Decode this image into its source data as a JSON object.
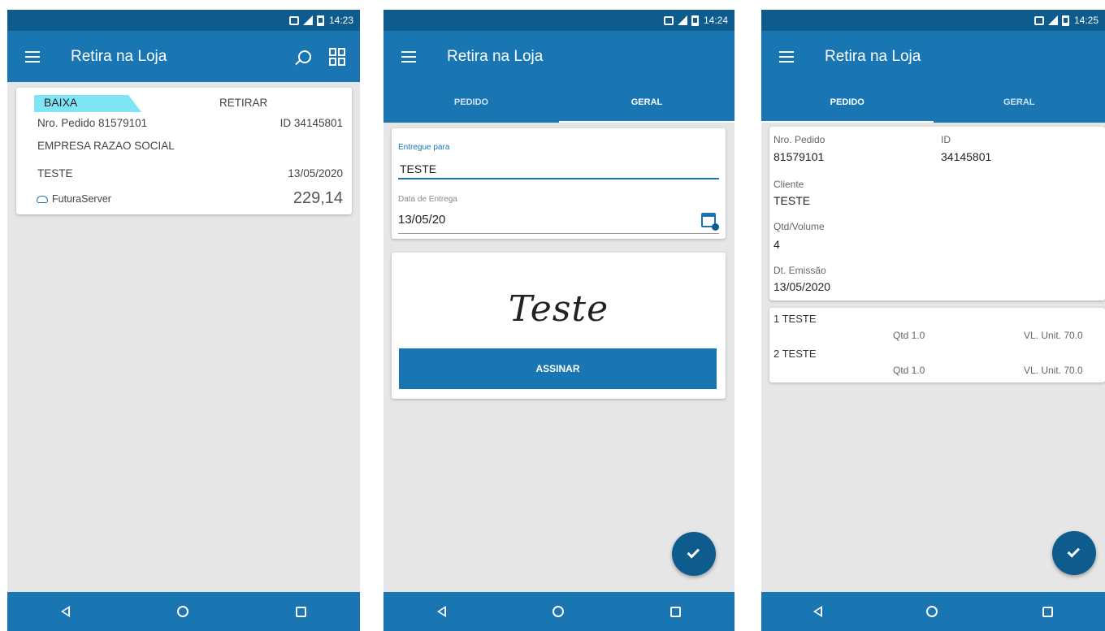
{
  "screens": [
    {
      "status_time": "14:23",
      "title": "Retira na Loja",
      "order_card": {
        "badge": "BAIXA",
        "action": "RETIRAR",
        "order_number": "Nro. Pedido 81579101",
        "id": "ID 34145801",
        "company": "EMPRESA RAZAO SOCIAL",
        "client": "TESTE",
        "date": "13/05/2020",
        "server": "FuturaServer",
        "amount": "229,14"
      }
    },
    {
      "status_time": "14:24",
      "title": "Retira na Loja",
      "tabs": [
        {
          "label": "PEDIDO",
          "active": false
        },
        {
          "label": "GERAL",
          "active": true
        }
      ],
      "delivered_to_label": "Entregue para",
      "delivered_to_value": "TESTE",
      "delivery_date_label": "Data de Entrega",
      "delivery_date_value": "13/05/20",
      "signature_text": "Teste",
      "sign_button": "ASSINAR"
    },
    {
      "status_time": "14:25",
      "title": "Retira na Loja",
      "tabs": [
        {
          "label": "PEDIDO",
          "active": true
        },
        {
          "label": "GERAL",
          "active": false
        }
      ],
      "details": {
        "order_label": "Nro. Pedido",
        "order_value": "81579101",
        "id_label": "ID",
        "id_value": "34145801",
        "client_label": "Cliente",
        "client_value": "TESTE",
        "qty_label": "Qtd/Volume",
        "qty_value": "4",
        "emission_label": "Dt. Emissão",
        "emission_value": "13/05/2020"
      },
      "items": [
        {
          "title": "1 TESTE",
          "qty": "Qtd 1.0",
          "unit": "VL. Unit. 70.0"
        },
        {
          "title": "2 TESTE",
          "qty": "Qtd 1.0",
          "unit": "VL. Unit. 70.0"
        }
      ]
    }
  ],
  "colors": {
    "primary": "#1976b3",
    "status_bar": "#0e5b8e",
    "badge": "#7fe4f3",
    "background": "#e6e6e6"
  },
  "icons": [
    "menu-icon",
    "search-icon",
    "qr-code-icon",
    "cloud-icon",
    "calendar-icon",
    "check-icon",
    "back-icon",
    "home-icon",
    "recents-icon"
  ]
}
